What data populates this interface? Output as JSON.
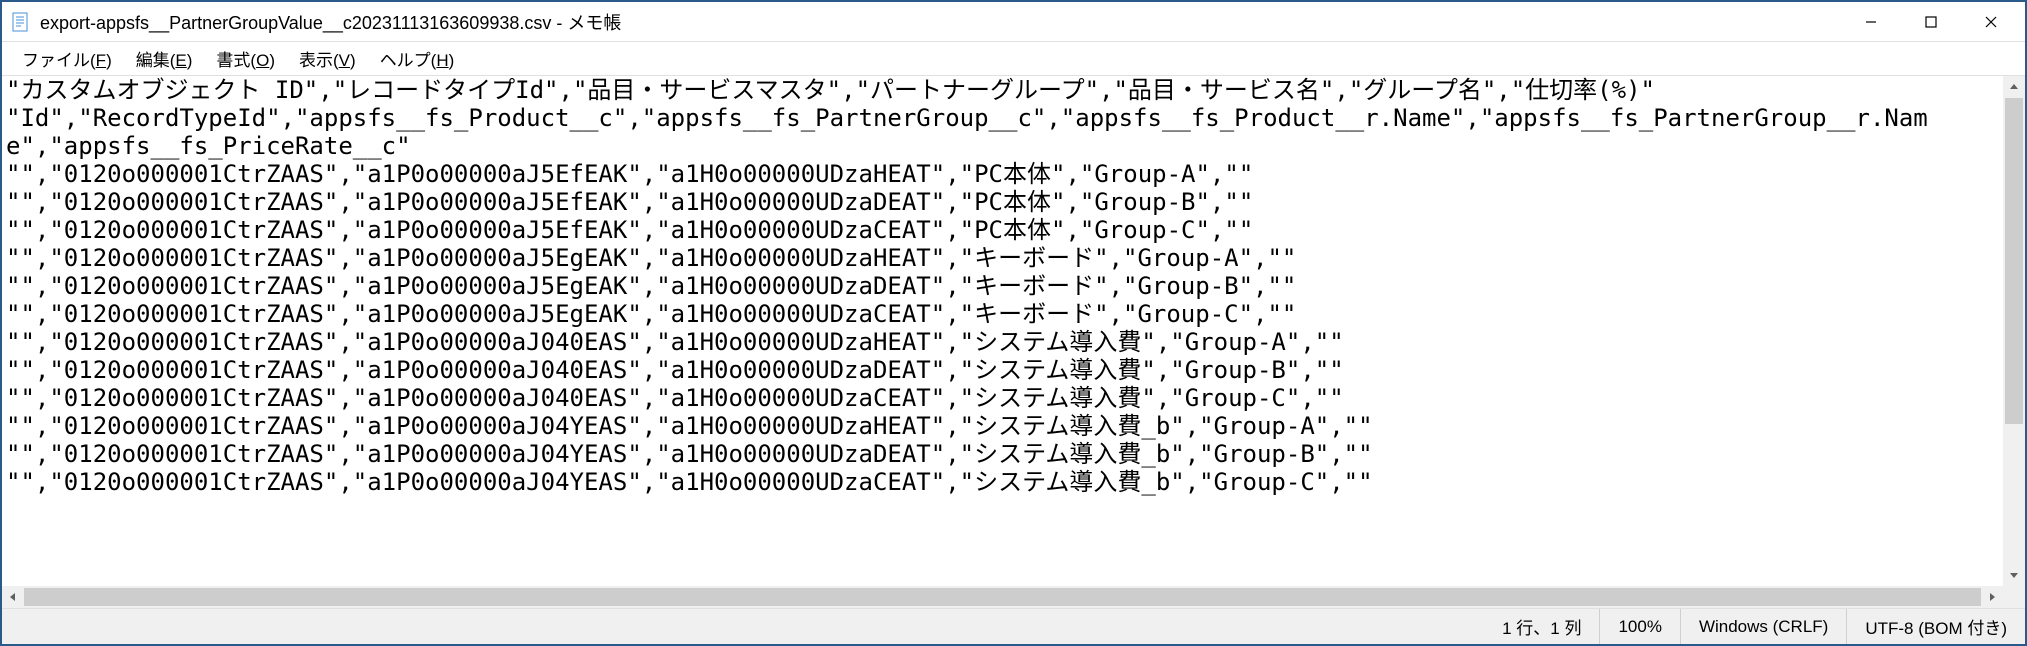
{
  "titlebar": {
    "title": "export-appsfs__PartnerGroupValue__c20231113163609938.csv - メモ帳"
  },
  "menu": {
    "file": "ファイル(",
    "file_accel": "F",
    "file_close": ")",
    "edit": "編集(",
    "edit_accel": "E",
    "edit_close": ")",
    "format": "書式(",
    "format_accel": "O",
    "format_close": ")",
    "view": "表示(",
    "view_accel": "V",
    "view_close": ")",
    "help": "ヘルプ(",
    "help_accel": "H",
    "help_close": ")"
  },
  "content": {
    "text": "\"カスタムオブジェクト ID\",\"レコードタイプId\",\"品目・サービスマスタ\",\"パートナーグループ\",\"品目・サービス名\",\"グループ名\",\"仕切率(%)\"\n\"Id\",\"RecordTypeId\",\"appsfs__fs_Product__c\",\"appsfs__fs_PartnerGroup__c\",\"appsfs__fs_Product__r.Name\",\"appsfs__fs_PartnerGroup__r.Name\",\"appsfs__fs_PriceRate__c\"\n\"\",\"0120o000001CtrZAAS\",\"a1P0o00000aJ5EfEAK\",\"a1H0o00000UDzaHEAT\",\"PC本体\",\"Group-A\",\"\"\n\"\",\"0120o000001CtrZAAS\",\"a1P0o00000aJ5EfEAK\",\"a1H0o00000UDzaDEAT\",\"PC本体\",\"Group-B\",\"\"\n\"\",\"0120o000001CtrZAAS\",\"a1P0o00000aJ5EfEAK\",\"a1H0o00000UDzaCEAT\",\"PC本体\",\"Group-C\",\"\"\n\"\",\"0120o000001CtrZAAS\",\"a1P0o00000aJ5EgEAK\",\"a1H0o00000UDzaHEAT\",\"キーボード\",\"Group-A\",\"\"\n\"\",\"0120o000001CtrZAAS\",\"a1P0o00000aJ5EgEAK\",\"a1H0o00000UDzaDEAT\",\"キーボード\",\"Group-B\",\"\"\n\"\",\"0120o000001CtrZAAS\",\"a1P0o00000aJ5EgEAK\",\"a1H0o00000UDzaCEAT\",\"キーボード\",\"Group-C\",\"\"\n\"\",\"0120o000001CtrZAAS\",\"a1P0o00000aJ040EAS\",\"a1H0o00000UDzaHEAT\",\"システム導入費\",\"Group-A\",\"\"\n\"\",\"0120o000001CtrZAAS\",\"a1P0o00000aJ040EAS\",\"a1H0o00000UDzaDEAT\",\"システム導入費\",\"Group-B\",\"\"\n\"\",\"0120o000001CtrZAAS\",\"a1P0o00000aJ040EAS\",\"a1H0o00000UDzaCEAT\",\"システム導入費\",\"Group-C\",\"\"\n\"\",\"0120o000001CtrZAAS\",\"a1P0o00000aJ04YEAS\",\"a1H0o00000UDzaHEAT\",\"システム導入費_b\",\"Group-A\",\"\"\n\"\",\"0120o000001CtrZAAS\",\"a1P0o00000aJ04YEAS\",\"a1H0o00000UDzaDEAT\",\"システム導入費_b\",\"Group-B\",\"\"\n\"\",\"0120o000001CtrZAAS\",\"a1P0o00000aJ04YEAS\",\"a1H0o00000UDzaCEAT\",\"システム導入費_b\",\"Group-C\",\"\""
  },
  "status": {
    "position": "1 行、1 列",
    "zoom": "100%",
    "lineending": "Windows (CRLF)",
    "encoding": "UTF-8 (BOM 付き)"
  }
}
